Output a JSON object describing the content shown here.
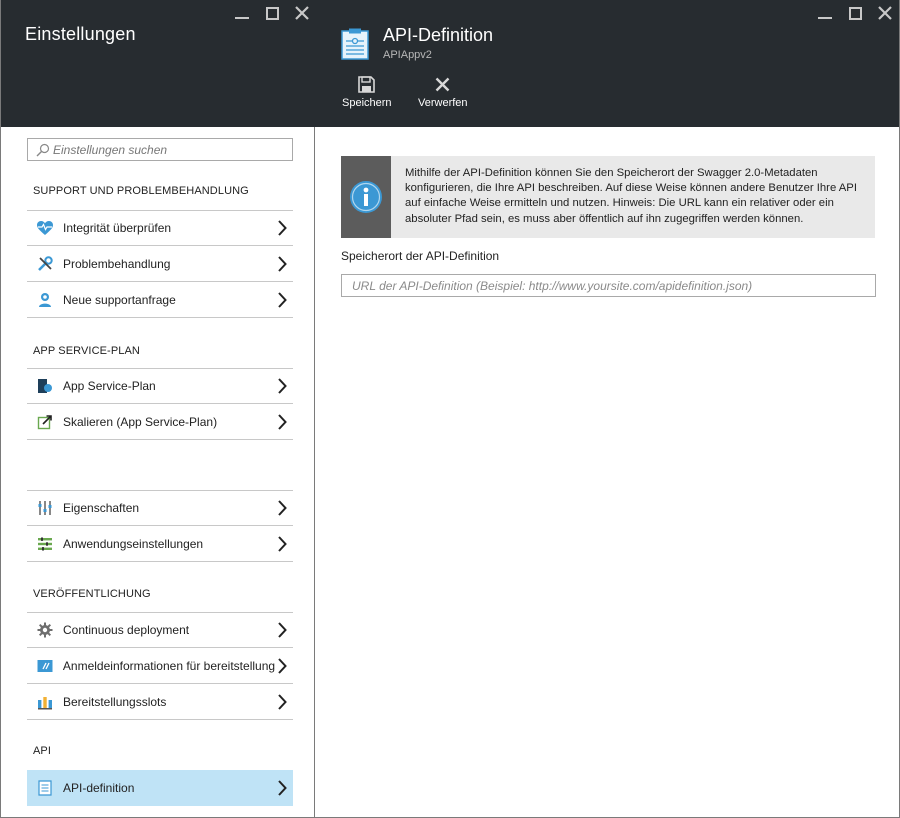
{
  "left_blade": {
    "title": "Einstellungen",
    "search": {
      "placeholder": "Einstellungen suchen"
    },
    "sections": [
      {
        "header": "SUPPORT UND PROBLEMBEHANDLUNG",
        "items": [
          {
            "label": "Integrität überprüfen",
            "icon": "heart-pulse-icon"
          },
          {
            "label": "Problembehandlung",
            "icon": "wrench-icon"
          },
          {
            "label": "Neue supportanfrage",
            "icon": "support-person-icon"
          }
        ]
      },
      {
        "header": "APP SERVICE-PLAN",
        "items": [
          {
            "label": "App Service-Plan",
            "icon": "app-service-plan-icon"
          },
          {
            "label": "Skalieren (App Service-Plan)",
            "icon": "scale-icon"
          }
        ]
      },
      {
        "header": "",
        "items": [
          {
            "label": "Eigenschaften",
            "icon": "sliders-icon"
          },
          {
            "label": "Anwendungseinstellungen",
            "icon": "settings-list-icon"
          }
        ]
      },
      {
        "header": "VERÖFFENTLICHUNG",
        "items": [
          {
            "label": "Continuous deployment",
            "icon": "gear-icon"
          },
          {
            "label": "Anmeldeinformationen für bereitstellung",
            "icon": "credentials-icon"
          },
          {
            "label": "Bereitstellungsslots",
            "icon": "slots-icon"
          }
        ]
      },
      {
        "header": "API",
        "items": [
          {
            "label": "API-definition",
            "icon": "api-definition-icon",
            "selected": true
          }
        ]
      }
    ]
  },
  "right_blade": {
    "title": "API-Definition",
    "subtitle": "APIAppv2",
    "commands": [
      {
        "label": "Speichern",
        "icon": "save-icon"
      },
      {
        "label": "Verwerfen",
        "icon": "discard-icon"
      }
    ],
    "info_text": "Mithilfe der API-Definition können Sie den Speicherort der Swagger 2.0-Metadaten konfigurieren, die Ihre API beschreiben. Auf diese Weise können andere Benutzer Ihre API auf einfache Weise ermitteln und nutzen. Hinweis: Die URL kann ein relativer oder ein absoluter Pfad sein, es muss aber öffentlich auf ihn zugegriffen werden können.",
    "field_label": "Speicherort der API-Definition",
    "field_placeholder": "URL der API-Definition (Beispiel: http://www.yoursite.com/apidefinition.json)",
    "field_value": ""
  },
  "colors": {
    "header_bg": "#272c30",
    "selected_bg": "#bfe3f6",
    "accent_blue": "#3b98d4",
    "info_strip": "#5c5c5c"
  }
}
